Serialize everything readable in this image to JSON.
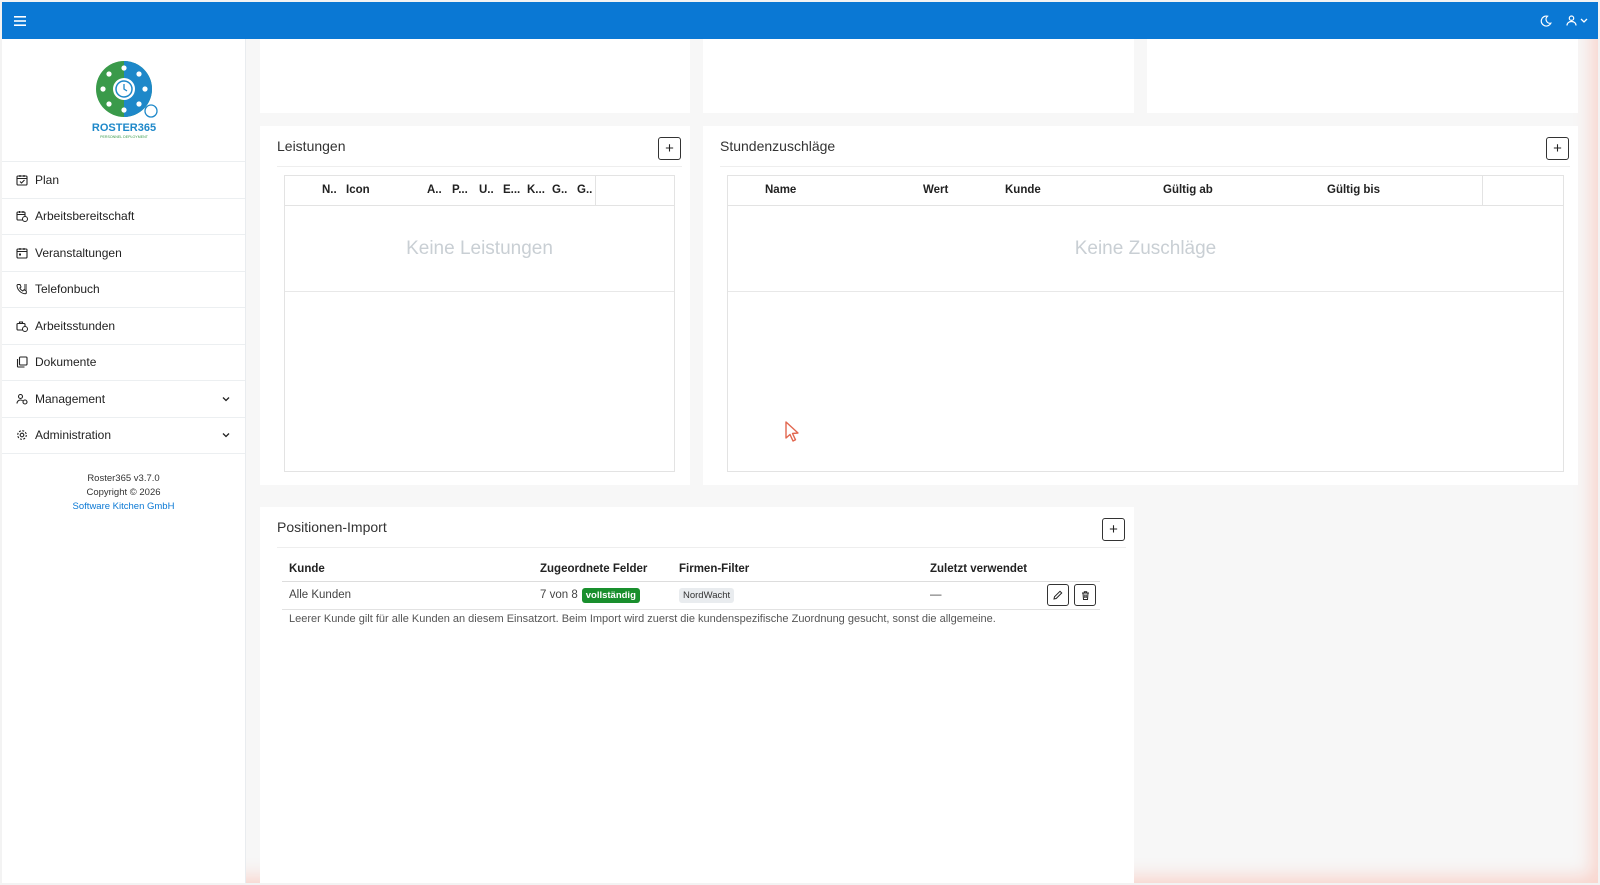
{
  "topbar": {
    "menu_icon": "hamburger-icon",
    "theme_icon": "moon-icon",
    "user_icon": "user-icon"
  },
  "sidebar": {
    "logo_text": "ROSTER365",
    "logo_sub": "PERSONNEL DEPLOYMENT",
    "items": [
      {
        "label": "Plan",
        "icon": "calendar-check-icon"
      },
      {
        "label": "Arbeitsbereitschaft",
        "icon": "calendar-clock-icon"
      },
      {
        "label": "Veranstaltungen",
        "icon": "calendar-icon"
      },
      {
        "label": "Telefonbuch",
        "icon": "phone-book-icon"
      },
      {
        "label": "Arbeitsstunden",
        "icon": "briefcase-clock-icon"
      },
      {
        "label": "Dokumente",
        "icon": "documents-icon"
      },
      {
        "label": "Management",
        "icon": "users-gear-icon"
      },
      {
        "label": "Administration",
        "icon": "gear-icon"
      }
    ],
    "footer": {
      "version": "Roster365 v3.7.0",
      "copyright": "Copyright © 2026",
      "company": "Software Kitchen GmbH"
    }
  },
  "leistungen": {
    "title": "Leistungen",
    "columns": [
      "N..",
      "Icon",
      "A..",
      "P...",
      "U..",
      "E...",
      "K...",
      "G..",
      "G.."
    ],
    "empty_text": "Keine Leistungen"
  },
  "zuschlaege": {
    "title": "Stundenzuschläge",
    "columns": [
      "Name",
      "Wert",
      "Kunde",
      "Gültig ab",
      "Gültig bis"
    ],
    "empty_text": "Keine Zuschläge"
  },
  "import": {
    "title": "Positionen-Import",
    "columns": [
      "Kunde",
      "Zugeordnete Felder",
      "Firmen-Filter",
      "Zuletzt verwendet"
    ],
    "row": {
      "kunde": "Alle Kunden",
      "felder": "7 von 8",
      "status": "vollständig",
      "filter": "NordWacht",
      "zuletzt": "—"
    },
    "hint": "Leerer Kunde gilt für alle Kunden an diesem Einsatzort. Beim Import wird zuerst die kundenspezifische Zuordnung gesucht, sonst die allgemeine."
  },
  "colors": {
    "primary": "#0a78d4",
    "success": "#198f2d"
  }
}
